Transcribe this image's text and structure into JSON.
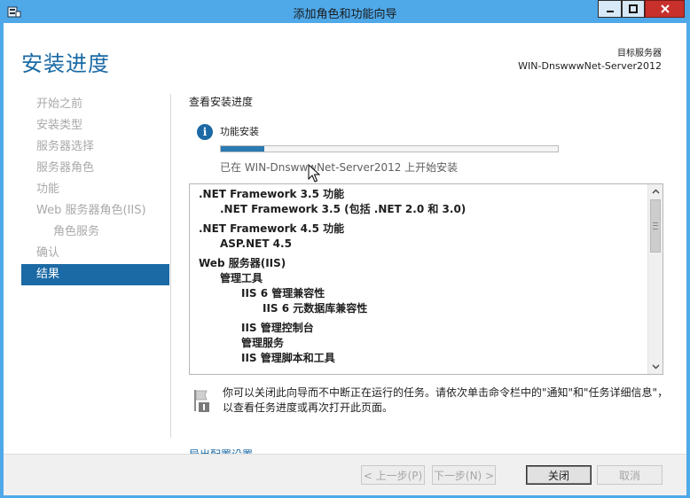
{
  "window": {
    "title": "添加角色和功能向导"
  },
  "header": {
    "page_title": "安装进度",
    "target_server_label": "目标服务器",
    "target_server_name": "WIN-DnswwwNet-Server2012"
  },
  "sidebar": {
    "items": [
      {
        "label": "开始之前"
      },
      {
        "label": "安装类型"
      },
      {
        "label": "服务器选择"
      },
      {
        "label": "服务器角色"
      },
      {
        "label": "功能"
      },
      {
        "label": "Web 服务器角色(IIS)"
      },
      {
        "label": "角色服务"
      },
      {
        "label": "确认"
      },
      {
        "label": "结果"
      }
    ]
  },
  "main": {
    "heading": "查看安装进度",
    "status_title": "功能安装",
    "progress_fraction": 0.13,
    "progress_note": "已在 WIN-DnswwwNet-Server2012 上开始安装",
    "features": [
      {
        "label": ".NET Framework 3.5 功能"
      },
      {
        "label": ".NET Framework 3.5 (包括 .NET 2.0 和 3.0)"
      },
      {
        "label": ".NET Framework 4.5 功能"
      },
      {
        "label": "ASP.NET 4.5"
      },
      {
        "label": "Web 服务器(IIS)"
      },
      {
        "label": "管理工具"
      },
      {
        "label": "IIS 6 管理兼容性"
      },
      {
        "label": "IIS 6 元数据库兼容性"
      },
      {
        "label": "IIS 管理控制台"
      },
      {
        "label": "管理服务"
      },
      {
        "label": "IIS 管理脚本和工具"
      }
    ],
    "notice": "你可以关闭此向导而不中断正在运行的任务。请依次单击命令栏中的\"通知\"和\"任务详细信息\"，以查看任务进度或再次打开此页面。",
    "export_link": "导出配置设置"
  },
  "footer": {
    "back_label": "< 上一步(P)",
    "next_label": "下一步(N) >",
    "close_label": "关闭",
    "cancel_label": "取消"
  },
  "colors": {
    "title_bar": "#4fa8e8",
    "accent": "#1b6aa5",
    "close_button": "#c7302b"
  }
}
